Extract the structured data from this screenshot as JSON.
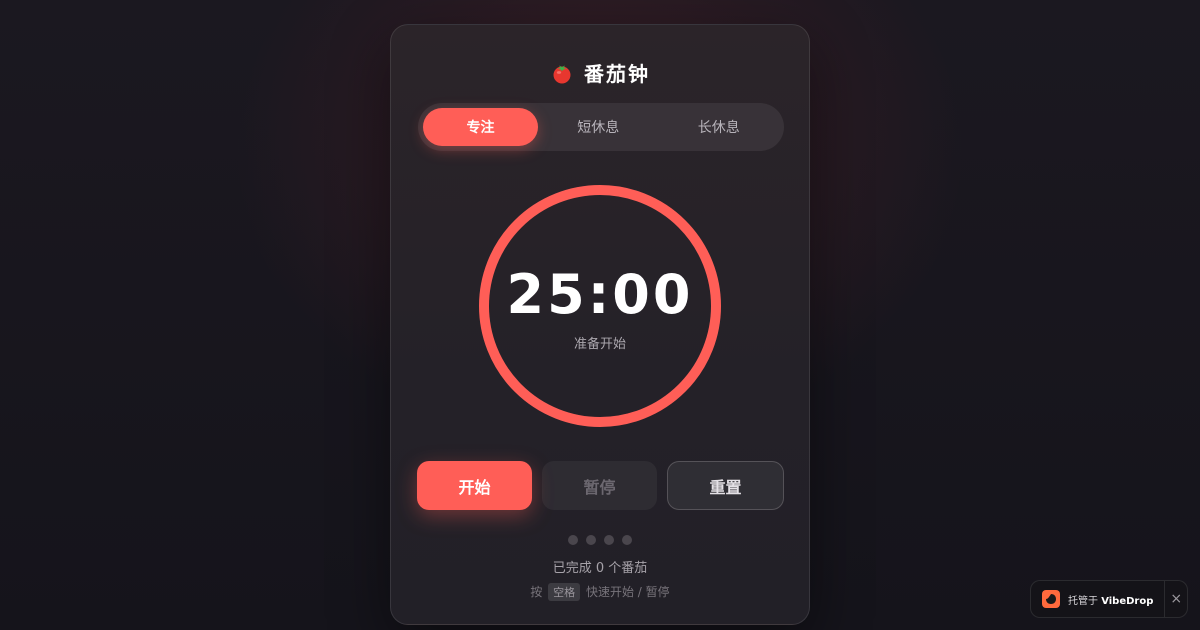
{
  "app": {
    "title": "番茄钟",
    "icon": "tomato-icon"
  },
  "tabs": [
    {
      "label": "专注",
      "active": true
    },
    {
      "label": "短休息",
      "active": false
    },
    {
      "label": "长休息",
      "active": false
    }
  ],
  "timer": {
    "time": "25:00",
    "status": "准备开始",
    "progress": 1.0
  },
  "controls": {
    "start_label": "开始",
    "pause_label": "暂停",
    "reset_label": "重置"
  },
  "session": {
    "dots_total": 4,
    "dots_filled": 0,
    "completed_text": "已完成 0 个番茄"
  },
  "hint": {
    "prefix": "按",
    "key": "空格",
    "suffix": "快速开始 / 暂停"
  },
  "badge": {
    "text_prefix": "托管于",
    "brand": "VibeDrop",
    "close": "×"
  },
  "colors": {
    "accent": "#ff5e57",
    "background": "#18161d",
    "card": "#262229"
  }
}
